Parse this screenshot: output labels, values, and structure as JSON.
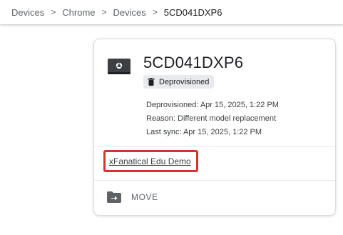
{
  "breadcrumb": {
    "items": [
      "Devices",
      "Chrome",
      "Devices"
    ],
    "current": "5CD041DXP6",
    "separator": ">"
  },
  "device": {
    "name": "5CD041DXP6",
    "status": "Deprovisioned",
    "details": {
      "deprovisioned": "Deprovisioned: Apr 15, 2025, 1:22 PM",
      "reason": "Reason: Different model replacement",
      "last_sync": "Last sync: Apr 15, 2025, 1:22 PM"
    },
    "org_unit": "xFanatical Edu Demo"
  },
  "actions": {
    "move_label": "MOVE"
  },
  "colors": {
    "highlight_border": "#d93030",
    "chip_bg": "#e8eaed",
    "text_primary": "#202124",
    "text_secondary": "#5f6368"
  },
  "icons": {
    "device": "chromebook-icon",
    "status": "trash-icon",
    "move": "folder-move-icon"
  }
}
